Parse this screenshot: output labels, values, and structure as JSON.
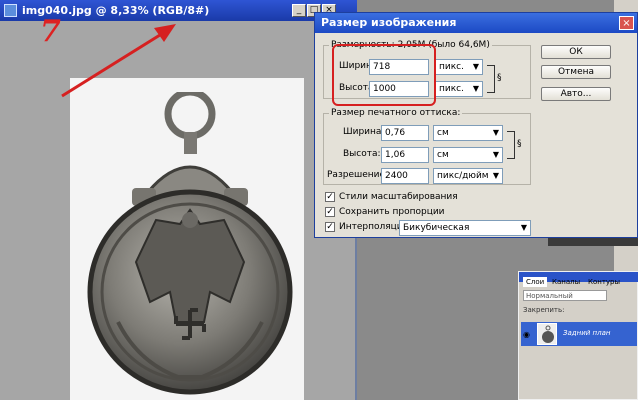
{
  "document": {
    "title": "img040.jpg @ 8,33% (RGB/8#)",
    "min_label": "_",
    "max_label": "□",
    "close_label": "×"
  },
  "annotation": {
    "step_number": "7"
  },
  "dialog": {
    "title": "Размер изображения",
    "close_label": "×",
    "pixel_dimensions_label": "Размерность:",
    "pixel_dimensions_value": "2,05М (было 64,6М)",
    "width_label": "Ширина:",
    "width_value": "718",
    "width_unit": "пикс.",
    "height_label": "Высота:",
    "height_value": "1000",
    "height_unit": "пикс.",
    "print_size_label": "Размер печатного оттиска:",
    "print_width_label": "Ширина:",
    "print_width_value": "0,76",
    "print_width_unit": "см",
    "print_height_label": "Высота:",
    "print_height_value": "1,06",
    "print_height_unit": "см",
    "resolution_label": "Разрешение:",
    "resolution_value": "2400",
    "resolution_unit": "пикс/дюйм",
    "scale_styles_label": "Стили масштабирования",
    "constrain_label": "Сохранить пропорции",
    "resample_label": "Интерполяция:",
    "resample_value": "Бикубическая",
    "ok_label": "ОК",
    "cancel_label": "Отмена",
    "auto_label": "Авто..."
  },
  "layers_panel": {
    "tabs": [
      "Слои",
      "Каналы",
      "Контуры"
    ],
    "blend_mode": "Нормальный",
    "lock_label": "Закрепить:",
    "layer_name": "Задний план"
  },
  "colors": {
    "highlight": "#d62020",
    "title_bar": "#1c49c4"
  }
}
